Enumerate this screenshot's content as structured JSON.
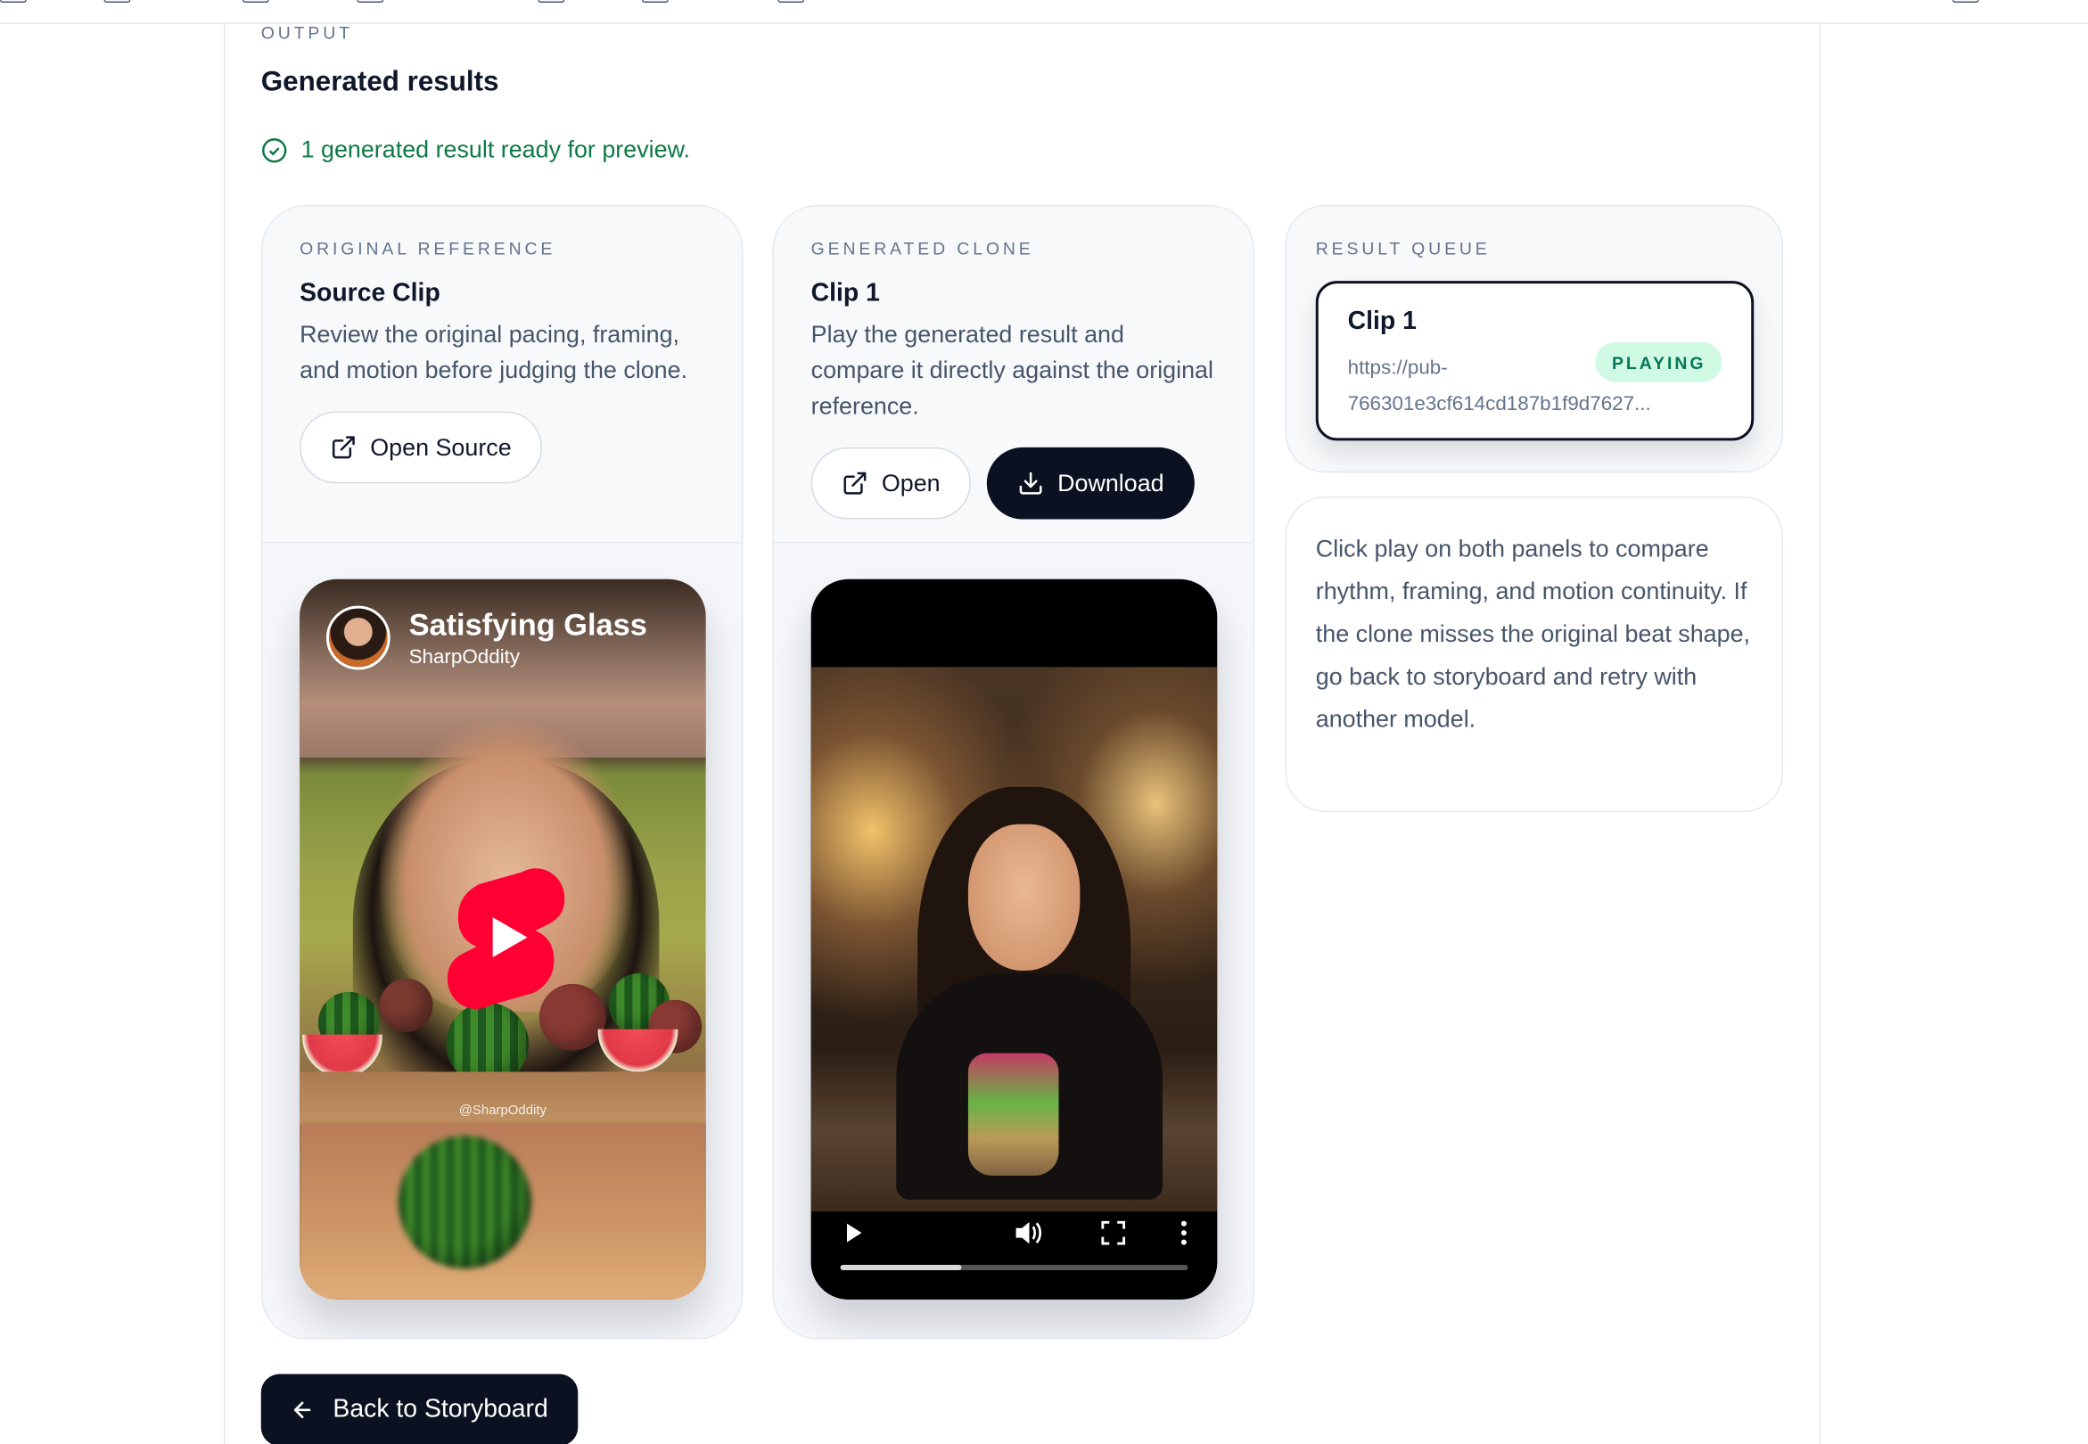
{
  "output": {
    "eyebrow": "OUTPUT",
    "title": "Generated results",
    "status": "1 generated result ready for preview."
  },
  "source_card": {
    "eyebrow": "ORIGINAL REFERENCE",
    "title": "Source Clip",
    "description": "Review the original pacing, framing, and motion before judging the clone.",
    "open_label": "Open Source",
    "video": {
      "title": "Satisfying Glass",
      "channel": "SharpOddity",
      "watermark": "@SharpOddity"
    }
  },
  "generated_card": {
    "eyebrow": "GENERATED CLONE",
    "title": "Clip 1",
    "description": "Play the generated result and compare it directly against the original reference.",
    "open_label": "Open",
    "download_label": "Download",
    "video": {
      "progress_percent": 35
    }
  },
  "queue": {
    "eyebrow": "RESULT QUEUE",
    "items": [
      {
        "title": "Clip 1",
        "url": "https://pub-766301e3cf614cd187b1f9d7627...",
        "status": "PLAYING"
      }
    ]
  },
  "note": "Click play on both panels to compare rhythm, framing, and motion continuity. If the clone misses the original beat shape, go back to storyboard and retry with another model.",
  "back_label": "Back to Storyboard",
  "colors": {
    "accent_dark": "#0b1120",
    "success": "#0e7a45",
    "badge_bg": "#d1fae5",
    "youtube_red": "#ff0033"
  }
}
